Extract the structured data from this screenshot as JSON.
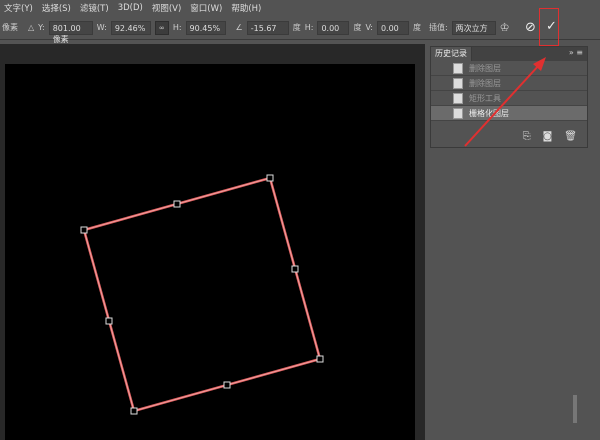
{
  "menu": [
    "文字(Y)",
    "选择(S)",
    "滤镜(T)",
    "3D(D)",
    "视图(V)",
    "窗口(W)",
    "帮助(H)"
  ],
  "options": {
    "x_unit": "像素",
    "y_label": "Y:",
    "y_value": "801.00 像素",
    "w_label": "W:",
    "w_value": "92.46%",
    "h_label": "H:",
    "h_value": "90.45%",
    "angle_value": "-15.67",
    "angle_unit": "度",
    "hskew_label": "H:",
    "hskew_value": "0.00",
    "hskew_unit": "度",
    "vskew_label": "V:",
    "vskew_value": "0.00",
    "vskew_unit": "度",
    "interp_label": "插值:",
    "interp_value": "两次立方"
  },
  "history": {
    "title": "历史记录",
    "items": [
      "删除图层",
      "删除图层",
      "矩形工具",
      "栅格化图层"
    ],
    "selected_index": 3
  },
  "colors": {
    "highlight": "#e03030",
    "transform": "#e06060"
  }
}
